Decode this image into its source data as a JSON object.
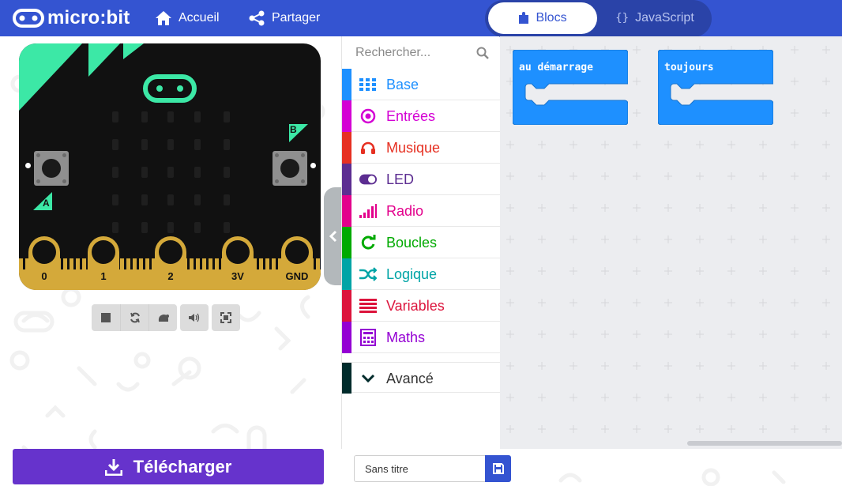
{
  "header": {
    "logo_text": "micro:bit",
    "nav": {
      "home_label": "Accueil",
      "share_label": "Partager"
    },
    "editor_toggle": {
      "blocks_label": "Blocs",
      "javascript_label": "JavaScript",
      "active": "Blocs"
    }
  },
  "simulator": {
    "button_a_label": "A",
    "button_b_label": "B",
    "pins": [
      "0",
      "1",
      "2",
      "3V",
      "GND"
    ],
    "controls": [
      "stop-icon",
      "restart-icon",
      "slow-mode-icon",
      "sound-icon",
      "fullscreen-icon"
    ]
  },
  "toolbox": {
    "search_placeholder": "Rechercher...",
    "categories": [
      {
        "label": "Base",
        "color": "#1e90ff",
        "icon": "grid-icon"
      },
      {
        "label": "Entrées",
        "color": "#d400d4",
        "icon": "target-icon"
      },
      {
        "label": "Musique",
        "color": "#e63022",
        "icon": "headphones-icon"
      },
      {
        "label": "LED",
        "color": "#5c2d91",
        "icon": "toggle-icon"
      },
      {
        "label": "Radio",
        "color": "#e3008c",
        "icon": "signal-bars-icon"
      },
      {
        "label": "Boucles",
        "color": "#00aa00",
        "icon": "loop-icon"
      },
      {
        "label": "Logique",
        "color": "#00a4a6",
        "icon": "shuffle-icon"
      },
      {
        "label": "Variables",
        "color": "#dc143c",
        "icon": "lines-icon"
      },
      {
        "label": "Maths",
        "color": "#9400d3",
        "icon": "calculator-icon"
      }
    ],
    "advanced": {
      "label": "Avancé",
      "color": "#002b2b",
      "icon": "chevron-down-icon"
    }
  },
  "workspace": {
    "blocks": [
      {
        "label": "au démarrage",
        "color": "#1e90ff"
      },
      {
        "label": "toujours",
        "color": "#1e90ff"
      }
    ]
  },
  "footer": {
    "download_label": "Télécharger",
    "project_name": "Sans titre",
    "save_icon": "save-icon"
  },
  "colors": {
    "header": "#3454d1",
    "download": "#6633cc",
    "board_accent": "#3ce8a6",
    "pin_gold": "#d4a93a"
  }
}
